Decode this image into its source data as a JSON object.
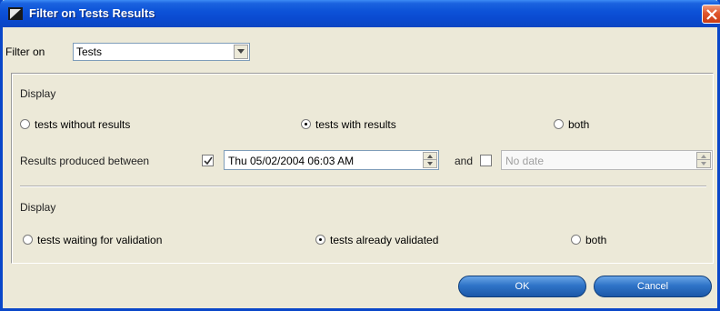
{
  "window": {
    "title": "Filter on Tests Results"
  },
  "filter": {
    "label": "Filter on",
    "selected": "Tests"
  },
  "results_section": {
    "label": "Display",
    "options": [
      {
        "label": "tests without results",
        "selected": false
      },
      {
        "label": "tests with results",
        "selected": true
      },
      {
        "label": "both",
        "selected": false
      }
    ],
    "date_range": {
      "label": "Results produced between",
      "start_checked": true,
      "start_value": "Thu 05/02/2004 06:03 AM",
      "connector": "and",
      "end_checked": false,
      "end_value": "No date"
    }
  },
  "validation_section": {
    "label": "Display",
    "options": [
      {
        "label": "tests waiting for validation",
        "selected": false
      },
      {
        "label": "tests already validated",
        "selected": true
      },
      {
        "label": "both",
        "selected": false
      }
    ]
  },
  "buttons": {
    "ok": "OK",
    "cancel": "Cancel"
  },
  "colors": {
    "titlebar": "#0a4ad0",
    "dialog_bg": "#ece9d8",
    "button_blue": "#2f74c8",
    "close_red": "#e0562c"
  }
}
